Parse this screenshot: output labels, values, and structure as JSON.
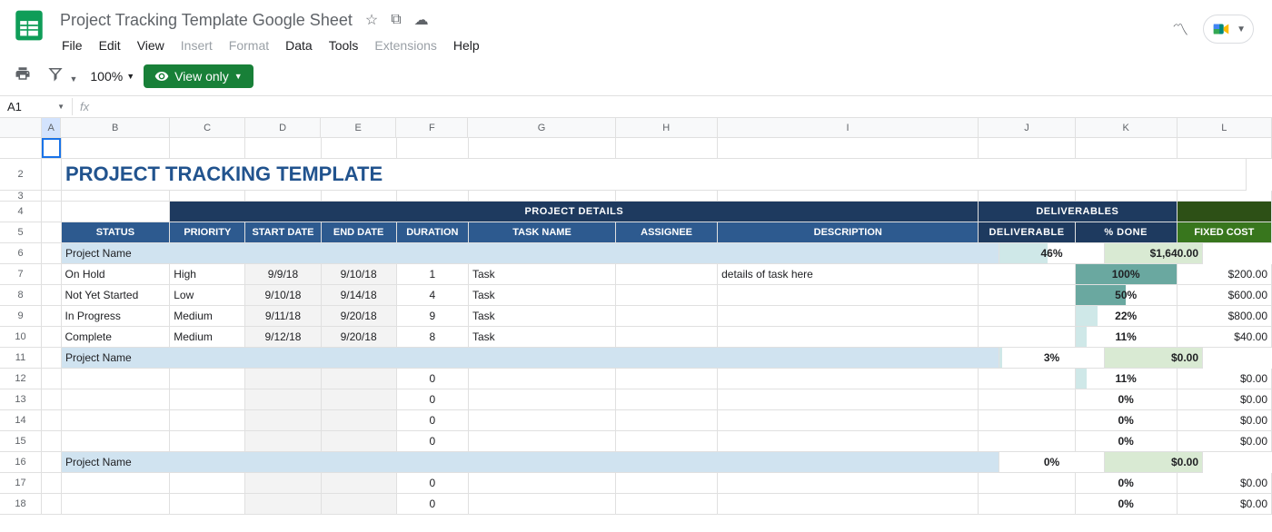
{
  "doc_title": "Project Tracking Template Google Sheet",
  "menus": [
    "File",
    "Edit",
    "View",
    "Insert",
    "Format",
    "Data",
    "Tools",
    "Extensions",
    "Help"
  ],
  "disabled_menus": [
    "Insert",
    "Format",
    "Extensions"
  ],
  "zoom": "100%",
  "view_only": "View only",
  "name_box": "A1",
  "fx_label": "fx",
  "col_labels": [
    "A",
    "B",
    "C",
    "D",
    "E",
    "F",
    "G",
    "H",
    "I",
    "J",
    "K",
    "L"
  ],
  "row_labels": [
    "",
    "2",
    "3",
    "4",
    "5",
    "6",
    "7",
    "8",
    "9",
    "10",
    "11",
    "12",
    "13",
    "14",
    "15",
    "16",
    "17",
    "18"
  ],
  "template_title": "PROJECT TRACKING TEMPLATE",
  "group_headers": {
    "project_details": "PROJECT DETAILS",
    "deliverables": "DELIVERABLES"
  },
  "headers": {
    "status": "STATUS",
    "priority": "PRIORITY",
    "start": "START DATE",
    "end": "END DATE",
    "duration": "DURATION",
    "task": "TASK NAME",
    "assignee": "ASSIGNEE",
    "desc": "DESCRIPTION",
    "deliverable": "DELIVERABLE",
    "pct": "% DONE",
    "cost": "FIXED COST"
  },
  "rows": [
    {
      "type": "section",
      "name": "Project Name",
      "pct": "46%",
      "pct_w": 46,
      "cost": "$1,640.00"
    },
    {
      "type": "task",
      "status": "On Hold",
      "priority": "High",
      "start": "9/9/18",
      "end": "9/10/18",
      "dur": "1",
      "task": "Task",
      "assignee": "",
      "desc": "details of task here",
      "deliv": "",
      "pct": "100%",
      "pct_w": 100,
      "cost": "$200.00"
    },
    {
      "type": "task",
      "status": "Not Yet Started",
      "priority": "Low",
      "start": "9/10/18",
      "end": "9/14/18",
      "dur": "4",
      "task": "Task",
      "assignee": "",
      "desc": "",
      "deliv": "",
      "pct": "50%",
      "pct_w": 50,
      "cost": "$600.00"
    },
    {
      "type": "task",
      "status": "In Progress",
      "priority": "Medium",
      "start": "9/11/18",
      "end": "9/20/18",
      "dur": "9",
      "task": "Task",
      "assignee": "",
      "desc": "",
      "deliv": "",
      "pct": "22%",
      "pct_w": 22,
      "cost": "$800.00"
    },
    {
      "type": "task",
      "status": "Complete",
      "priority": "Medium",
      "start": "9/12/18",
      "end": "9/20/18",
      "dur": "8",
      "task": "Task",
      "assignee": "",
      "desc": "",
      "deliv": "",
      "pct": "11%",
      "pct_w": 11,
      "cost": "$40.00"
    },
    {
      "type": "section",
      "name": "Project Name",
      "pct": "3%",
      "pct_w": 3,
      "cost": "$0.00"
    },
    {
      "type": "task",
      "status": "",
      "priority": "",
      "start": "",
      "end": "",
      "dur": "0",
      "task": "",
      "assignee": "",
      "desc": "",
      "deliv": "",
      "pct": "11%",
      "pct_w": 11,
      "cost": "$0.00"
    },
    {
      "type": "task",
      "status": "",
      "priority": "",
      "start": "",
      "end": "",
      "dur": "0",
      "task": "",
      "assignee": "",
      "desc": "",
      "deliv": "",
      "pct": "0%",
      "pct_w": 0,
      "cost": "$0.00"
    },
    {
      "type": "task",
      "status": "",
      "priority": "",
      "start": "",
      "end": "",
      "dur": "0",
      "task": "",
      "assignee": "",
      "desc": "",
      "deliv": "",
      "pct": "0%",
      "pct_w": 0,
      "cost": "$0.00"
    },
    {
      "type": "task",
      "status": "",
      "priority": "",
      "start": "",
      "end": "",
      "dur": "0",
      "task": "",
      "assignee": "",
      "desc": "",
      "deliv": "",
      "pct": "0%",
      "pct_w": 0,
      "cost": "$0.00"
    },
    {
      "type": "section",
      "name": "Project Name",
      "pct": "0%",
      "pct_w": 0,
      "cost": "$0.00"
    },
    {
      "type": "task",
      "status": "",
      "priority": "",
      "start": "",
      "end": "",
      "dur": "0",
      "task": "",
      "assignee": "",
      "desc": "",
      "deliv": "",
      "pct": "0%",
      "pct_w": 0,
      "cost": "$0.00"
    },
    {
      "type": "task",
      "status": "",
      "priority": "",
      "start": "",
      "end": "",
      "dur": "0",
      "task": "",
      "assignee": "",
      "desc": "",
      "deliv": "",
      "pct": "0%",
      "pct_w": 0,
      "cost": "$0.00"
    }
  ]
}
